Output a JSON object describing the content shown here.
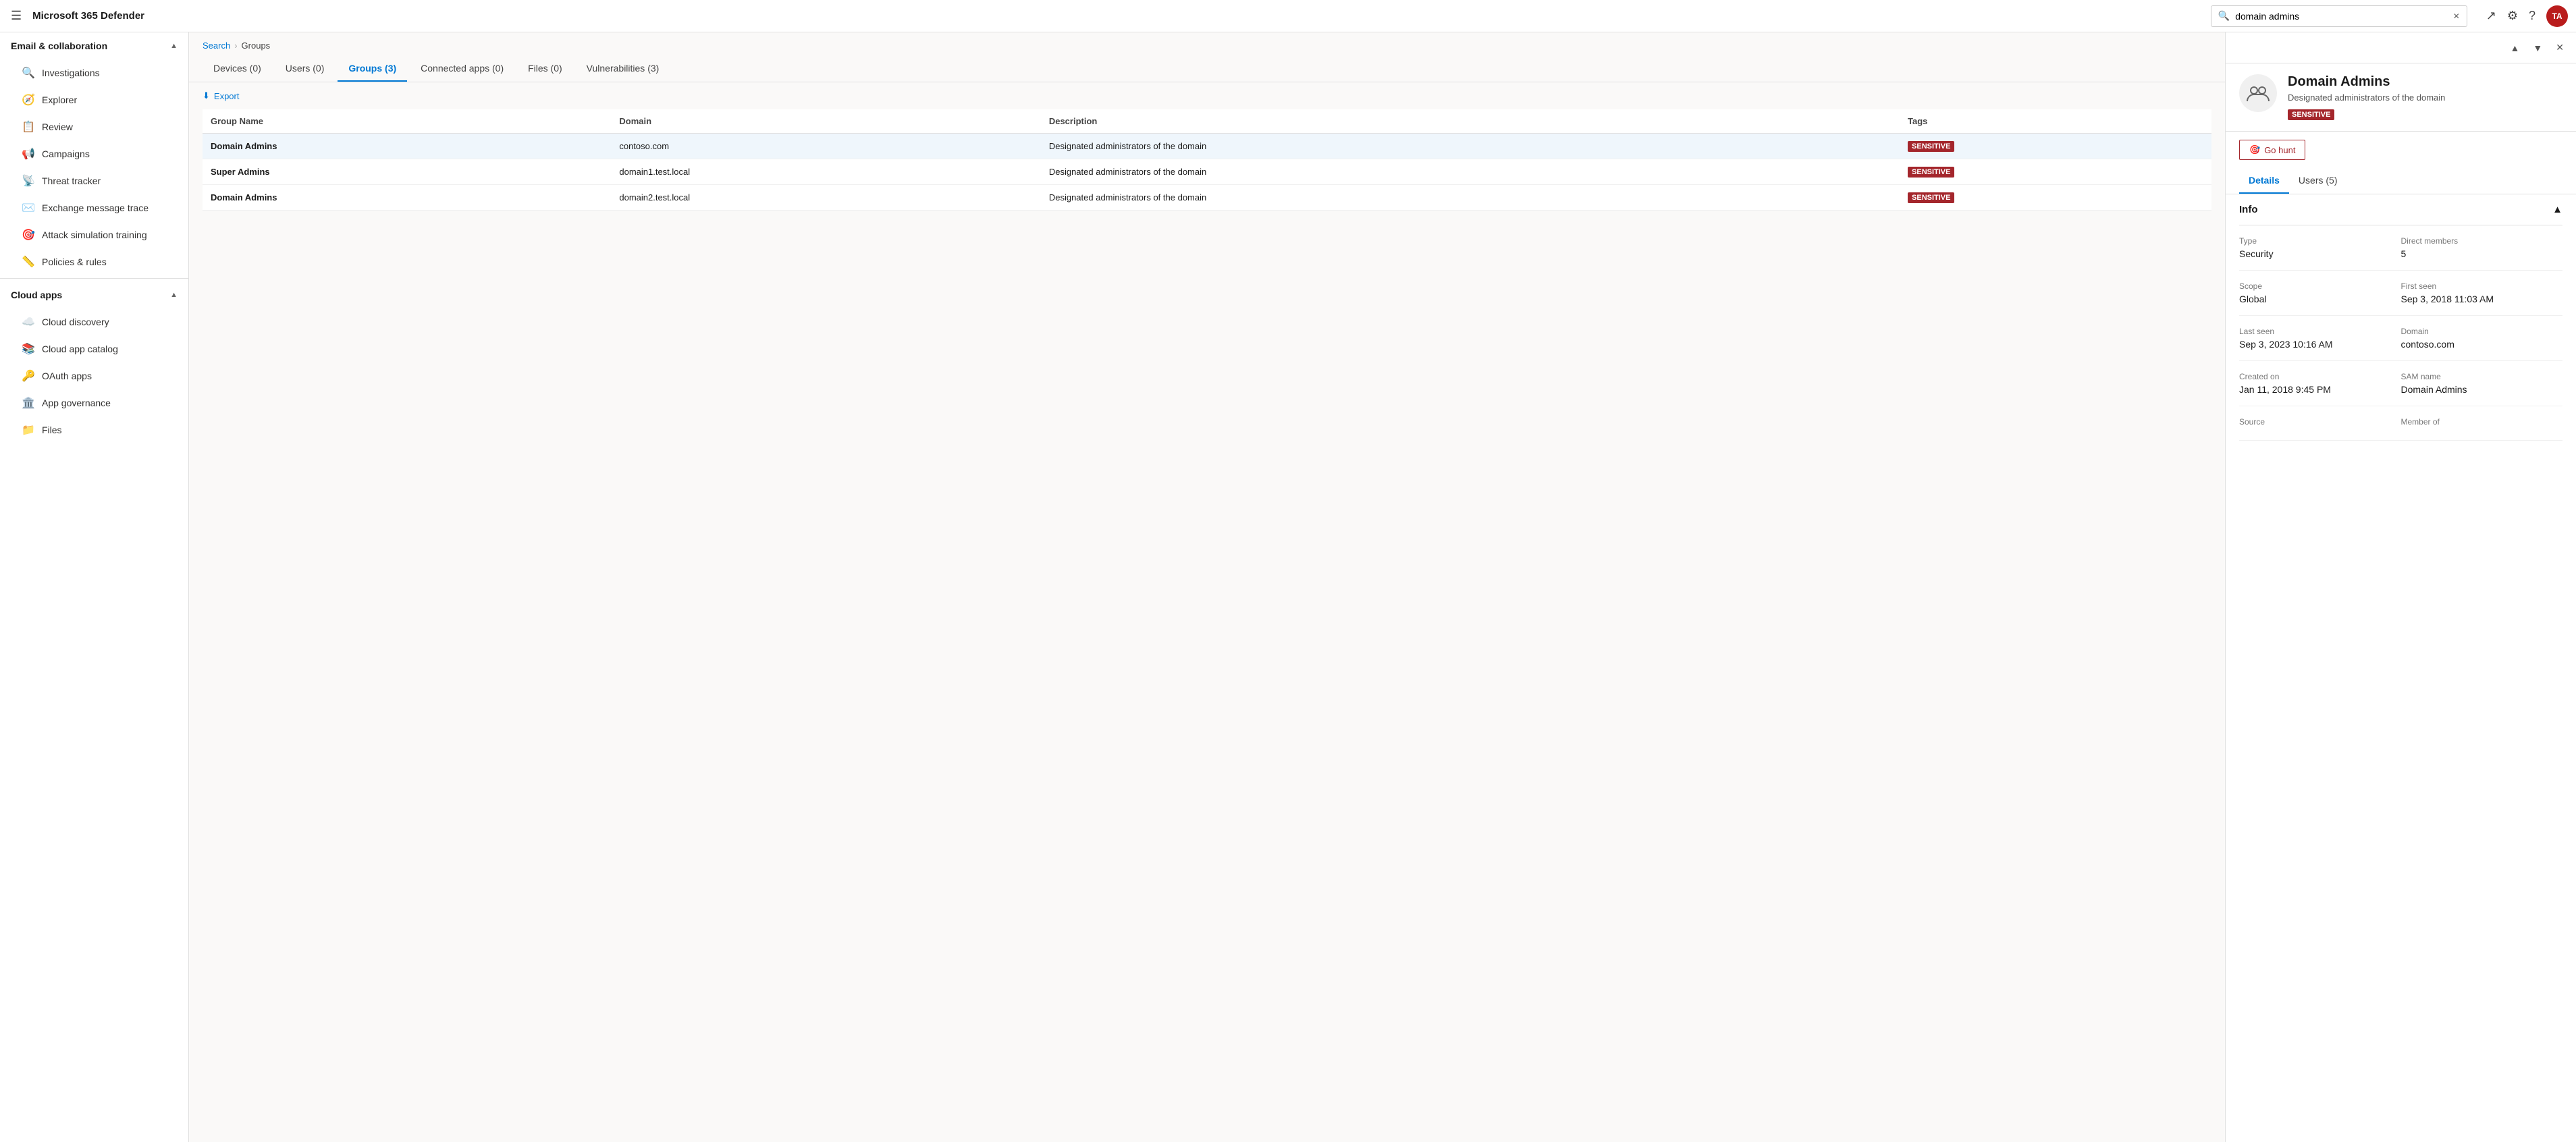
{
  "app": {
    "title": "Microsoft 365 Defender"
  },
  "topbar": {
    "search_placeholder": "domain admins",
    "search_value": "domain admins",
    "avatar_initials": "TA"
  },
  "sidebar": {
    "sections": [
      {
        "key": "email",
        "label": "Email & collaboration",
        "expanded": true,
        "items": [
          {
            "key": "investigations",
            "label": "Investigations",
            "icon": "🔍"
          },
          {
            "key": "explorer",
            "label": "Explorer",
            "icon": "🧭"
          },
          {
            "key": "review",
            "label": "Review",
            "icon": "📋"
          },
          {
            "key": "campaigns",
            "label": "Campaigns",
            "icon": "📢"
          },
          {
            "key": "threat-tracker",
            "label": "Threat tracker",
            "icon": "📡"
          },
          {
            "key": "exchange-message-trace",
            "label": "Exchange message trace",
            "icon": "✉️"
          },
          {
            "key": "attack-simulation-training",
            "label": "Attack simulation training",
            "icon": "🎯"
          },
          {
            "key": "policies-rules",
            "label": "Policies & rules",
            "icon": "📏"
          }
        ]
      },
      {
        "key": "cloud-apps",
        "label": "Cloud apps",
        "expanded": true,
        "items": [
          {
            "key": "cloud-discovery",
            "label": "Cloud discovery",
            "icon": "☁️"
          },
          {
            "key": "cloud-app-catalog",
            "label": "Cloud app catalog",
            "icon": "📚"
          },
          {
            "key": "oauth-apps",
            "label": "OAuth apps",
            "icon": "🔑"
          },
          {
            "key": "app-governance",
            "label": "App governance",
            "icon": "🏛️"
          },
          {
            "key": "files",
            "label": "Files",
            "icon": "📁"
          }
        ]
      }
    ]
  },
  "breadcrumb": {
    "items": [
      "Search",
      "Groups"
    ]
  },
  "tabs": [
    {
      "key": "devices",
      "label": "Devices (0)"
    },
    {
      "key": "users",
      "label": "Users (0)"
    },
    {
      "key": "groups",
      "label": "Groups (3)",
      "active": true
    },
    {
      "key": "connected-apps",
      "label": "Connected apps (0)"
    },
    {
      "key": "files",
      "label": "Files (0)"
    },
    {
      "key": "vulnerabilities",
      "label": "Vulnerabilities (3)"
    }
  ],
  "table": {
    "columns": [
      "Group Name",
      "Domain",
      "Description",
      "Tags"
    ],
    "rows": [
      {
        "name": "Domain Admins",
        "domain": "contoso.com",
        "description": "Designated administrators of the domain",
        "tag": "SENSITIVE",
        "selected": true
      },
      {
        "name": "Super Admins",
        "domain": "domain1.test.local",
        "description": "Designated administrators of the domain",
        "tag": "SENSITIVE",
        "selected": false
      },
      {
        "name": "Domain Admins",
        "domain": "domain2.test.local",
        "description": "Designated administrators of the domain",
        "tag": "SENSITIVE",
        "selected": false
      }
    ]
  },
  "export_label": "Export",
  "detail": {
    "group_name": "Domain Admins",
    "subtitle": "Designated administrators of the domain",
    "sensitive_label": "SENSITIVE",
    "go_hunt_label": "Go hunt",
    "tabs": [
      {
        "key": "details",
        "label": "Details",
        "active": true
      },
      {
        "key": "users",
        "label": "Users (5)"
      }
    ],
    "info_section_label": "Info",
    "fields": [
      {
        "label": "Type",
        "value": "Security",
        "col": "left"
      },
      {
        "label": "Direct members",
        "value": "5",
        "col": "right"
      },
      {
        "label": "Scope",
        "value": "Global",
        "col": "left"
      },
      {
        "label": "First seen",
        "value": "Sep 3, 2018 11:03 AM",
        "col": "right"
      },
      {
        "label": "Last seen",
        "value": "Sep 3, 2023 10:16 AM",
        "col": "left"
      },
      {
        "label": "Domain",
        "value": "contoso.com",
        "col": "right"
      },
      {
        "label": "Created on",
        "value": "Jan 11, 2018 9:45 PM",
        "col": "left"
      },
      {
        "label": "SAM name",
        "value": "Domain Admins",
        "col": "right"
      },
      {
        "label": "Source",
        "value": "",
        "col": "left"
      },
      {
        "label": "Member of",
        "value": "",
        "col": "right"
      }
    ]
  }
}
